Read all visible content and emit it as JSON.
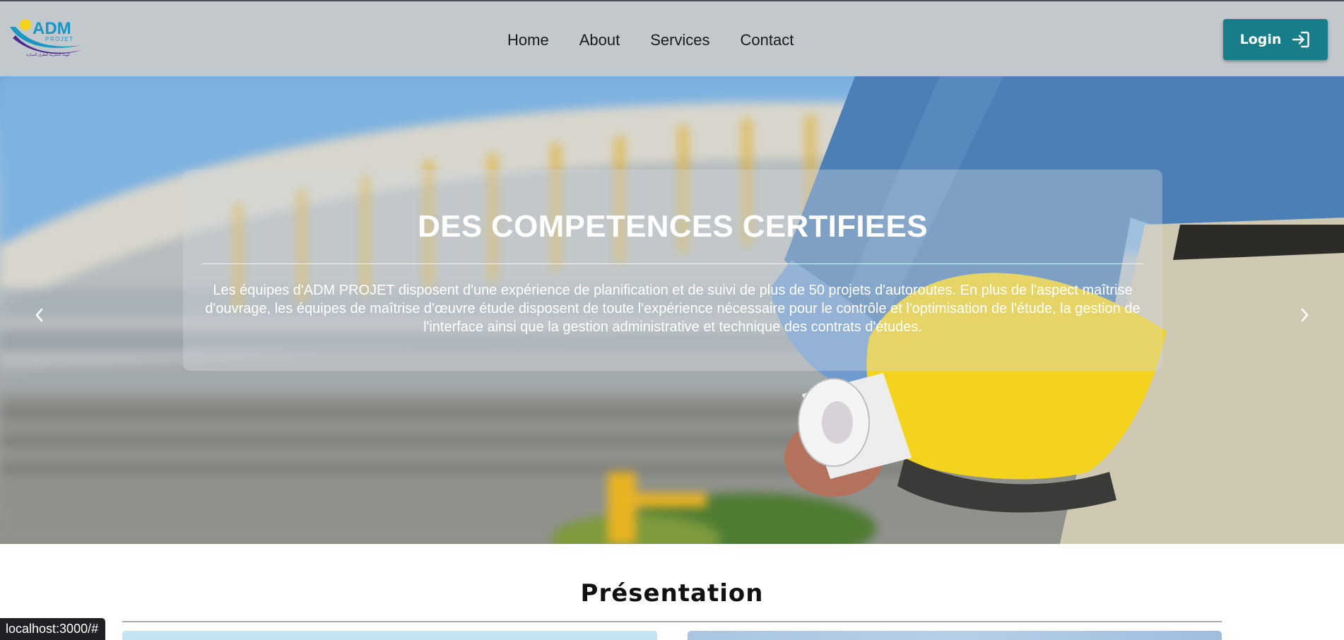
{
  "brand": {
    "logo_text": "ADM",
    "logo_subtext": "PROJET",
    "logo_tagline": "الهيئة المغربية للطرق السيارة"
  },
  "nav": {
    "links": [
      "Home",
      "About",
      "Services",
      "Contact"
    ],
    "login_label": "Login",
    "login_icon": "login-icon"
  },
  "hero": {
    "title": "DES COMPETENCES CERTIFIEES",
    "text": "Les équipes d'ADM PROJET disposent d'une expérience de planification et de suivi de plus de 50 projets d'autoroutes. En plus de l'aspect maîtrise d'ouvrage, les équipes de maîtrise d'œuvre étude disposent de toute l'expérience nécessaire pour le contrôle et l'optimisation de l'étude, la gestion de l'interface ainsi que la gestion administrative et technique des contrats d'études.",
    "prev_icon": "chevron-left-icon",
    "next_icon": "chevron-right-icon"
  },
  "presentation": {
    "title": "Présentation"
  },
  "status_bar": {
    "url": "localhost:3000/#"
  },
  "colors": {
    "navbar_bg": "#c3c8cd",
    "accent": "#167d89",
    "logo_blue": "#1a96c4",
    "logo_yellow": "#f2d21b",
    "logo_purple": "#4b2a8c"
  }
}
